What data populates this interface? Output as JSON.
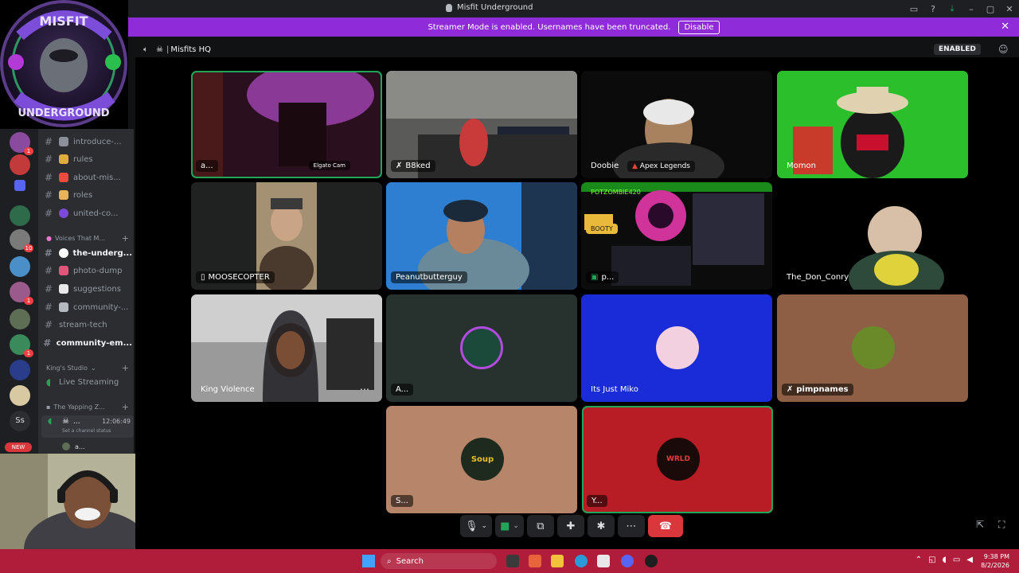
{
  "titlebar": {
    "app_title": "Misfit Underground",
    "ai_label": "Ai"
  },
  "banner": {
    "text": "Streamer Mode is enabled. Usernames have been truncated.",
    "disable_label": "Disable"
  },
  "corner_logo": {
    "top_text": "MISFIT",
    "bottom_text": "UNDERGROUND"
  },
  "guild_badges": [
    "1",
    "10",
    "1",
    "1"
  ],
  "channels": [
    {
      "label": "introduce-...",
      "bold": false
    },
    {
      "label": "rules",
      "bold": false
    },
    {
      "label": "about-mis...",
      "bold": false
    },
    {
      "label": "roles",
      "bold": false
    },
    {
      "label": "united-co...",
      "bold": false
    }
  ],
  "category_voices": "Voices That M...",
  "channels2": [
    {
      "label": "the-underg...",
      "bold": true
    },
    {
      "label": "photo-dump",
      "bold": false
    },
    {
      "label": "suggestions",
      "bold": false
    },
    {
      "label": "community-...",
      "bold": false
    },
    {
      "label": "stream-tech",
      "bold": false
    },
    {
      "label": "community-em...",
      "bold": true
    }
  ],
  "category_kings": "King's Studio",
  "live_streaming": "Live Streaming",
  "category_yapping": "The Yapping Z...",
  "voice_status": {
    "name": "...",
    "timer": "12:06:49",
    "hint": "Set a channel status",
    "user": "a..."
  },
  "server_initials": "Ss",
  "new_label": "NEW",
  "voice_header": {
    "channel": "Misfits HQ",
    "enabled": "ENABLED"
  },
  "tiles": {
    "t1": {
      "name": "a...",
      "cam": "Elgato Cam"
    },
    "t2": {
      "name": "B8ked"
    },
    "t3": {
      "name": "Doobie",
      "game": "Apex Legends"
    },
    "t4": {
      "name": "Momon"
    },
    "t5": {
      "name": "MOOSECOPTER"
    },
    "t6": {
      "name": "Peanutbutterguy"
    },
    "t7": {
      "name": "p...",
      "overlay": "POTZOMBIE420",
      "booty": "BOOTY"
    },
    "t8": {
      "name": "The_Don_Conry"
    },
    "t9": {
      "name": "King Violence"
    },
    "t10": {
      "name": "A..."
    },
    "t11": {
      "name": "Its Just Miko"
    },
    "t12": {
      "name": "pimpnames"
    },
    "t13": {
      "name": "S...",
      "logo": "Soup"
    },
    "t14": {
      "name": "Y...",
      "logo": "WRLD"
    }
  },
  "taskbar": {
    "search": "Search",
    "time": "9:38 PM",
    "date": "8/2/2026"
  }
}
